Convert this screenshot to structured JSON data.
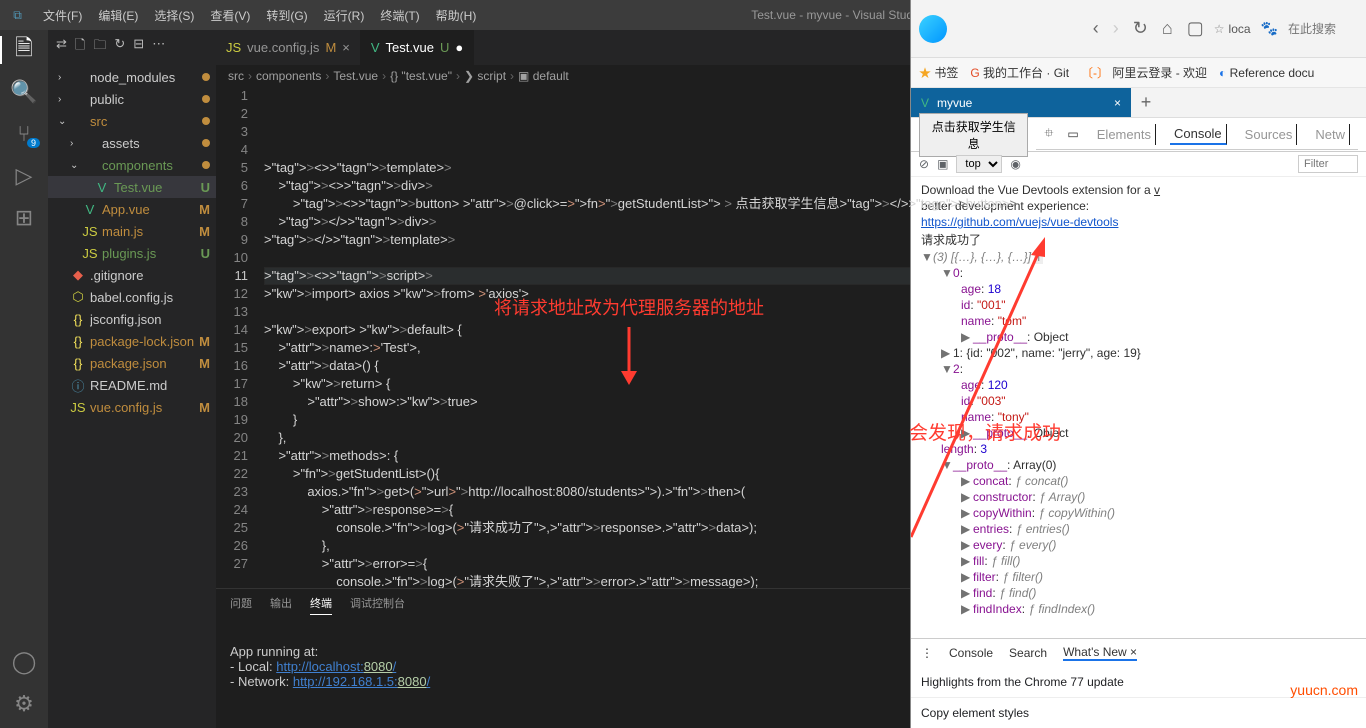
{
  "titlebar": {
    "menus": [
      "文件(F)",
      "编辑(E)",
      "选择(S)",
      "查看(V)",
      "转到(G)",
      "运行(R)",
      "终端(T)",
      "帮助(H)"
    ],
    "title": "Test.vue - myvue - Visual Studio Code"
  },
  "activity": {
    "scm_badge": "9"
  },
  "explorer": {
    "items": [
      {
        "chev": "›",
        "ico": "",
        "lbl": "node_modules",
        "cls": "",
        "badge": "dot"
      },
      {
        "chev": "›",
        "ico": "",
        "lbl": "public",
        "cls": "",
        "badge": "dot"
      },
      {
        "chev": "⌄",
        "ico": "",
        "lbl": "src",
        "cls": "yellow",
        "badge": "dot"
      },
      {
        "chev": "›",
        "ico": "",
        "lbl": "assets",
        "cls": "",
        "badge": "dot",
        "indent": 1
      },
      {
        "chev": "⌄",
        "ico": "",
        "lbl": "components",
        "cls": "green",
        "badge": "dot",
        "indent": 1
      },
      {
        "chev": "",
        "ico": "V",
        "icls": "vue",
        "lbl": "Test.vue",
        "cls": "green sel",
        "badge": "U",
        "indent": 2
      },
      {
        "chev": "",
        "ico": "V",
        "icls": "vue",
        "lbl": "App.vue",
        "cls": "yellow",
        "badge": "M",
        "indent": 1
      },
      {
        "chev": "",
        "ico": "JS",
        "icls": "js",
        "lbl": "main.js",
        "cls": "yellow",
        "badge": "M",
        "indent": 1
      },
      {
        "chev": "",
        "ico": "JS",
        "icls": "js",
        "lbl": "plugins.js",
        "cls": "green",
        "badge": "U",
        "indent": 1
      },
      {
        "chev": "",
        "ico": "◆",
        "icls": "git",
        "lbl": ".gitignore",
        "cls": "",
        "badge": "",
        "indent": 0
      },
      {
        "chev": "",
        "ico": "⬡",
        "icls": "js",
        "lbl": "babel.config.js",
        "cls": "",
        "badge": "",
        "indent": 0
      },
      {
        "chev": "",
        "ico": "{}",
        "icls": "json",
        "lbl": "jsconfig.json",
        "cls": "",
        "badge": "",
        "indent": 0
      },
      {
        "chev": "",
        "ico": "{}",
        "icls": "json",
        "lbl": "package-lock.json",
        "cls": "yellow",
        "badge": "M",
        "indent": 0
      },
      {
        "chev": "",
        "ico": "{}",
        "icls": "json",
        "lbl": "package.json",
        "cls": "yellow",
        "badge": "M",
        "indent": 0
      },
      {
        "chev": "",
        "ico": "ⓘ",
        "icls": "md",
        "lbl": "README.md",
        "cls": "",
        "badge": "",
        "indent": 0
      },
      {
        "chev": "",
        "ico": "JS",
        "icls": "js",
        "lbl": "vue.config.js",
        "cls": "yellow",
        "badge": "M",
        "indent": 0
      }
    ]
  },
  "tabs": [
    {
      "ico": "JS",
      "icls": "js",
      "lbl": "vue.config.js",
      "mod": "M",
      "active": false
    },
    {
      "ico": "V",
      "icls": "vue",
      "lbl": "Test.vue",
      "mod": "U",
      "active": true,
      "dirty": true
    }
  ],
  "breadcrumb": [
    "src",
    "components",
    "Test.vue",
    "{} \"test.vue\"",
    "❯ script",
    "▣ default"
  ],
  "code_lines": [
    "<template>",
    "    <div>",
    "        <button @click=\"getStudentList\" > 点击获取学生信息</button>",
    "    </div>",
    "</template>",
    "",
    "<script>",
    "import axios from 'axios'",
    "",
    "export default {",
    "    name:'Test',",
    "    data() {",
    "        return {",
    "            show:true",
    "        }",
    "    },",
    "    methods: {",
    "        getStudentList(){",
    "            axios.get(\"http://localhost:8080/students\").then(",
    "                response=>{",
    "                    console.log(\"请求成功了\",response.data);",
    "                },",
    "                error=>{",
    "                    console.log(\"请求失败了\",error.message);",
    "                })",
    "        }",
    "    },"
  ],
  "current_line": 11,
  "annotation1": "将请求地址改为代理服务器的地址",
  "annotation2": "会发现，请求成功",
  "panel": {
    "tabs": [
      "问题",
      "输出",
      "终端",
      "调试控制台"
    ],
    "active": 2,
    "lines": {
      "l1": "App running at:",
      "l2a": "- Local:   ",
      "l2b": "http://localhost:",
      "l2c": "8080",
      "l2d": "/",
      "l3a": "- Network: ",
      "l3b": "http://192.168.1.5:",
      "l3c": "8080",
      "l3d": "/"
    }
  },
  "browser": {
    "url": "loca",
    "search_placeholder": "在此搜索",
    "bookmarks": [
      {
        "ico": "★",
        "lbl": "书签",
        "cls": "star"
      },
      {
        "ico": "G",
        "lbl": "我的工作台 · Git",
        "color": "#e34c26"
      },
      {
        "ico": "〔-〕",
        "lbl": "阿里云登录 - 欢迎",
        "color": "#ff6a00"
      },
      {
        "ico": "◐",
        "lbl": "Reference docu",
        "color": "#1a73e8"
      }
    ],
    "tab_title": "myvue",
    "page_button": "点击获取学生信息",
    "devtools_tabs": [
      "Elements",
      "Console",
      "Sources",
      "Netw"
    ],
    "devtools_active": 1,
    "top_label": "top",
    "filter_placeholder": "Filter",
    "console_msg1a": "Download the Vue Devtools extension for a ",
    "console_msg1b": "better development experience:",
    "console_link": "https://github.com/vuejs/vue-devtools",
    "console_success": "请求成功了",
    "console_arr_hdr": "(3) [{…}, {…}, {…}]",
    "obj0": {
      "age": "18",
      "id": "\"001\"",
      "name": "\"tom\""
    },
    "obj1": "1: {id: \"002\", name: \"jerry\", age: 19}",
    "obj2": {
      "age": "120",
      "id": "\"003\"",
      "name": "\"tony\""
    },
    "length_lbl": "length",
    "length_val": "3",
    "proto_lbl": "__proto__",
    "proto_obj": "Object",
    "proto_arr": "Array(0)",
    "proto_methods": [
      [
        "concat",
        "concat()"
      ],
      [
        "constructor",
        "Array()"
      ],
      [
        "copyWithin",
        "copyWithin()"
      ],
      [
        "entries",
        "entries()"
      ],
      [
        "every",
        "every()"
      ],
      [
        "fill",
        "fill()"
      ],
      [
        "filter",
        "filter()"
      ],
      [
        "find",
        "find()"
      ],
      [
        "findIndex",
        "findIndex()"
      ]
    ],
    "btm_tabs": [
      "Console",
      "Search",
      "What's New"
    ],
    "btm_hl1": "Highlights from the Chrome 77 update",
    "btm_hl2": "Copy element styles",
    "watermark": "yuucn.com"
  }
}
